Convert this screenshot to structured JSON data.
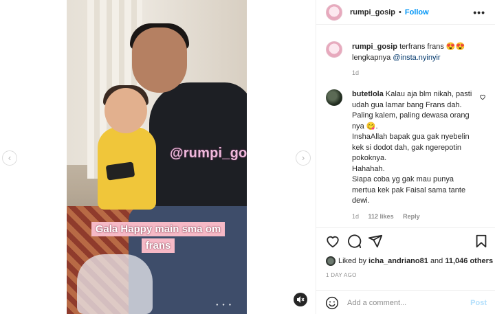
{
  "media": {
    "watermark": "@rumpi_gosip",
    "caption_line1": "Gala Happy main sma om",
    "caption_line2": "frans",
    "prev_icon": "chevron-left-icon",
    "next_icon": "chevron-right-icon",
    "mute_icon": "speaker-muted-icon",
    "carousel_dots": "● ● ●"
  },
  "header": {
    "username": "rumpi_gosip",
    "separator": "•",
    "follow_label": "Follow",
    "more_icon": "more-horizontal-icon"
  },
  "caption": {
    "username": "rumpi_gosip",
    "text": "terfrans frans 😍😍",
    "text2": "lengkapnya",
    "mention": "@insta.nyinyir",
    "timestamp": "1d"
  },
  "comment": {
    "username": "butetlola",
    "lines": [
      "Kalau aja blm nikah, pasti",
      "udah gua lamar bang Frans dah.",
      "Paling kalem, paling dewasa orang",
      "nya 😋.",
      "InshaAllah bapak gua gak nyebelin",
      "kek si dodot dah, gak ngerepotin",
      "pokoknya.",
      "Hahahah.",
      "Siapa coba yg gak mau punya",
      "mertua kek pak Faisal sama tante",
      "dewi."
    ],
    "time": "1d",
    "likes": "112 likes",
    "reply_label": "Reply"
  },
  "actions": {
    "liked_by_prefix": "Liked by",
    "liked_by_user": "icha_andriano81",
    "liked_by_and": "and",
    "liked_by_count": "11,046 others",
    "date": "1 DAY AGO",
    "add_comment_placeholder": "Add a comment...",
    "post_label": "Post"
  },
  "colors": {
    "accent_blue": "#0095f6",
    "post_disabled": "#b2dffc",
    "muted_text": "#8e8e8e"
  }
}
